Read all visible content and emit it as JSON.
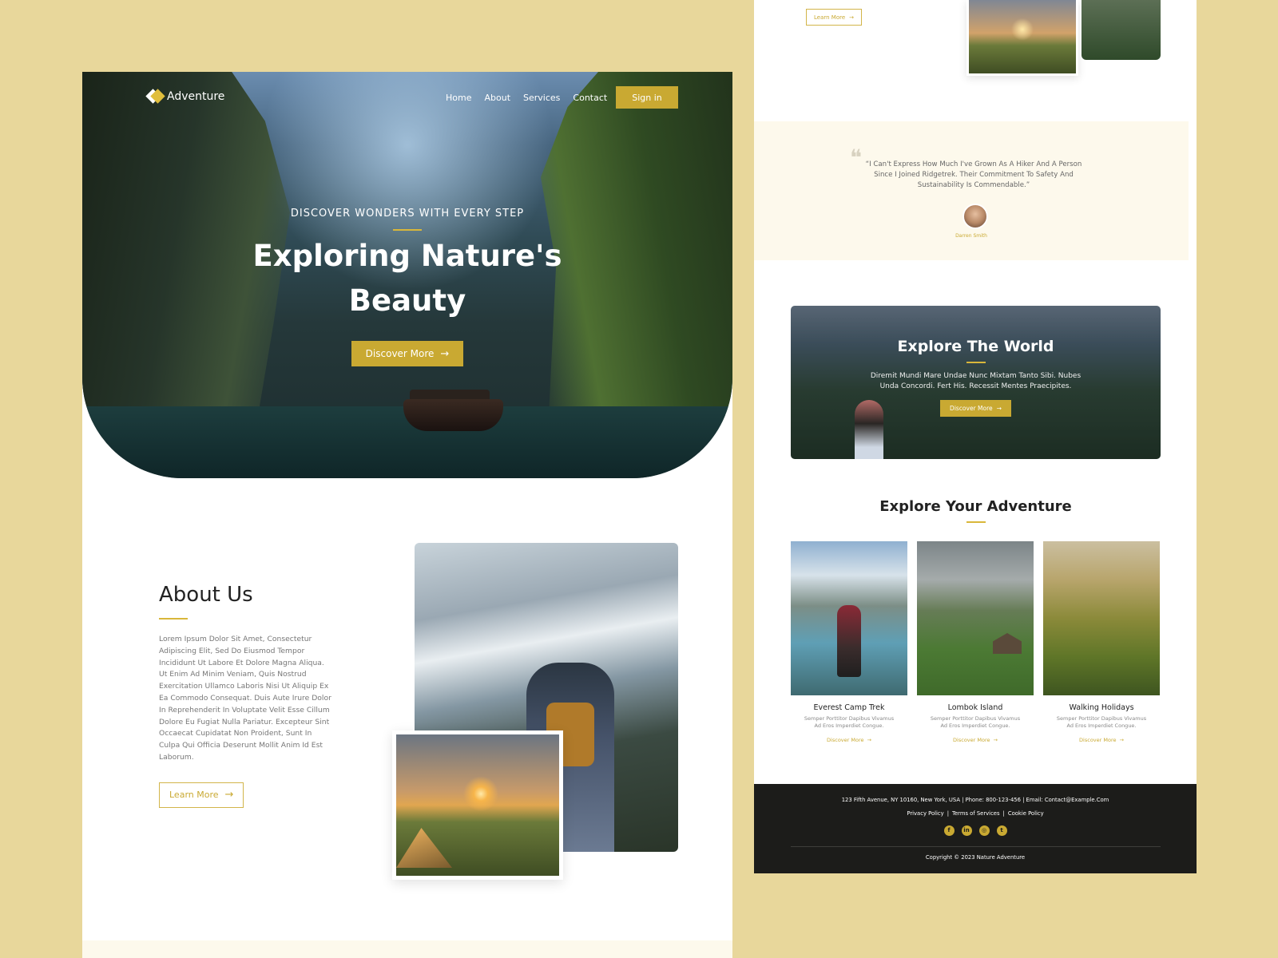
{
  "colors": {
    "background": "#E8D79B",
    "accent": "#C9A932",
    "footer": "#1c1c1a",
    "testimonial_bg": "#FDF9EC"
  },
  "left": {
    "nav": {
      "brand": "Adventure",
      "links": [
        "Home",
        "About",
        "Services",
        "Contact"
      ],
      "sign_in": "Sign in"
    },
    "hero": {
      "eyebrow": "DISCOVER WONDERS WITH EVERY STEP",
      "title_line1": "Exploring Nature's",
      "title_line2": "Beauty",
      "button": "Discover More"
    },
    "about": {
      "title": "About Us",
      "body": "Lorem Ipsum Dolor Sit Amet, Consectetur Adipiscing Elit, Sed Do Eiusmod Tempor Incididunt Ut Labore Et Dolore Magna Aliqua. Ut Enim Ad Minim Veniam, Quis Nostrud Exercitation Ullamco Laboris Nisi Ut Aliquip Ex Ea Commodo Consequat. Duis Aute Irure Dolor In Reprehenderit In Voluptate Velit Esse Cillum Dolore Eu Fugiat Nulla Pariatur. Excepteur Sint Occaecat Cupidatat Non Proident, Sunt In Culpa Qui Officia Deserunt Mollit Anim Id Est Laborum.",
      "button": "Learn More"
    }
  },
  "right": {
    "top_button": "Learn More",
    "testimonial": {
      "quote": "“I Can't Express How Much I've Grown As A Hiker And A Person Since I Joined Ridgetrek. Their Commitment To Safety And Sustainability Is Commendable.”",
      "author": "Darren Smith"
    },
    "banner": {
      "title": "Explore The World",
      "text": "Diremit Mundi Mare Undae Nunc Mixtam Tanto Sibi. Nubes Unda Concordi. Fert His. Recessit Mentes Praecipites.",
      "button": "Discover More"
    },
    "adventure": {
      "title": "Explore Your Adventure",
      "cards": [
        {
          "title": "Everest Camp Trek",
          "desc": "Semper Porttitor Dapibus Vivamus Ad Eros Imperdiet Congue.",
          "link": "Discover More"
        },
        {
          "title": "Lombok Island",
          "desc": "Semper Porttitor Dapibus Vivamus Ad Eros Imperdiet Congue.",
          "link": "Discover More"
        },
        {
          "title": "Walking Holidays",
          "desc": "Semper Porttitor Dapibus Vivamus Ad Eros Imperdiet Congue.",
          "link": "Discover More"
        }
      ]
    },
    "footer": {
      "address": "123 Fifth Avenue, NY 10160, New York, USA | Phone: 800-123-456 | Email: Contact@Example.Com",
      "links": [
        "Privacy Policy",
        "Terms of Services",
        "Cookie Policy"
      ],
      "separator": "|",
      "social": [
        {
          "icon": "facebook-icon",
          "glyph": "f"
        },
        {
          "icon": "linkedin-icon",
          "glyph": "in"
        },
        {
          "icon": "instagram-icon",
          "glyph": "◎"
        },
        {
          "icon": "twitter-icon",
          "glyph": "t"
        }
      ],
      "copyright": "Copyright © 2023 Nature Adventure"
    }
  }
}
